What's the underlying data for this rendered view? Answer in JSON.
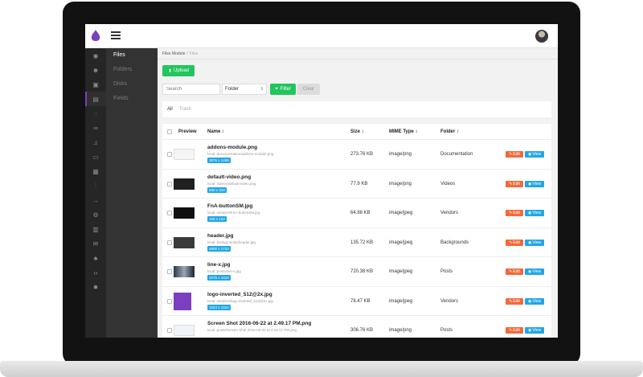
{
  "nav": {
    "sections": [
      "Files",
      "Folders",
      "Disks",
      "Fields"
    ]
  },
  "breadcrumb": {
    "parent": "Files Module",
    "separator": "/",
    "current": "Files"
  },
  "toolbar": {
    "upload_label": "Upload",
    "search_placeholder": "Search",
    "folder_select": "Folder",
    "filter_label": "Filter",
    "clear_label": "Clear"
  },
  "tabs": [
    "All",
    "Trash"
  ],
  "table": {
    "columns": [
      "Preview",
      "Name ↕",
      "Size ↕",
      "MIME Type ↕",
      "Folder ↕"
    ],
    "rows": [
      {
        "name": "addons-module.png",
        "path": "local::documentation/addons-module.png",
        "dims": "2876 x 1499",
        "size": "273.76 KB",
        "mime": "image/png",
        "folder": "Documentation",
        "thumb": "white"
      },
      {
        "name": "default-video.png",
        "path": "local::videos/default-video.png",
        "dims": "500 x 318",
        "size": "77.9 KB",
        "mime": "image/png",
        "folder": "Videos",
        "thumb": "dark"
      },
      {
        "name": "FnA-buttonSM.jpg",
        "path": "local::vendors/FnA-buttonSM.jpg",
        "dims": "168 x 133",
        "size": "64.88 KB",
        "mime": "image/jpeg",
        "folder": "Vendors",
        "thumb": "black"
      },
      {
        "name": "header.jpg",
        "path": "local::backgrounds/header.jpg",
        "dims": "2800 x 1733",
        "size": "135.72 KB",
        "mime": "image/jpeg",
        "folder": "Backgrounds",
        "thumb": "gray"
      },
      {
        "name": "line-x.jpg",
        "path": "local::posts/line-x.jpg",
        "dims": "2276 x 1410",
        "size": "720.38 KB",
        "mime": "image/jpeg",
        "folder": "Posts",
        "thumb": "photo"
      },
      {
        "name": "logo-inverted_512@2x.jpg",
        "path": "local::vendors/logo-inverted_512@2x.jpg",
        "dims": "1024 x 1024",
        "size": "78.47 KB",
        "mime": "image/jpeg",
        "folder": "Vendors",
        "thumb": "purple"
      },
      {
        "name": "Screen Shot 2016-06-22 at 2.49.17 PM.png",
        "path": "local::posts/Screen Shot 2016-06-22 at 2.49.17 PM.png",
        "dims": "",
        "size": "306.76 KB",
        "mime": "image/png",
        "folder": "Posts",
        "thumb": "light"
      }
    ],
    "edit_label": "Edit",
    "view_label": "View"
  },
  "colors": {
    "accent": "#22c55e",
    "info": "#22a6e8",
    "danger": "#f26a3b",
    "brand": "#7b3fbf"
  }
}
